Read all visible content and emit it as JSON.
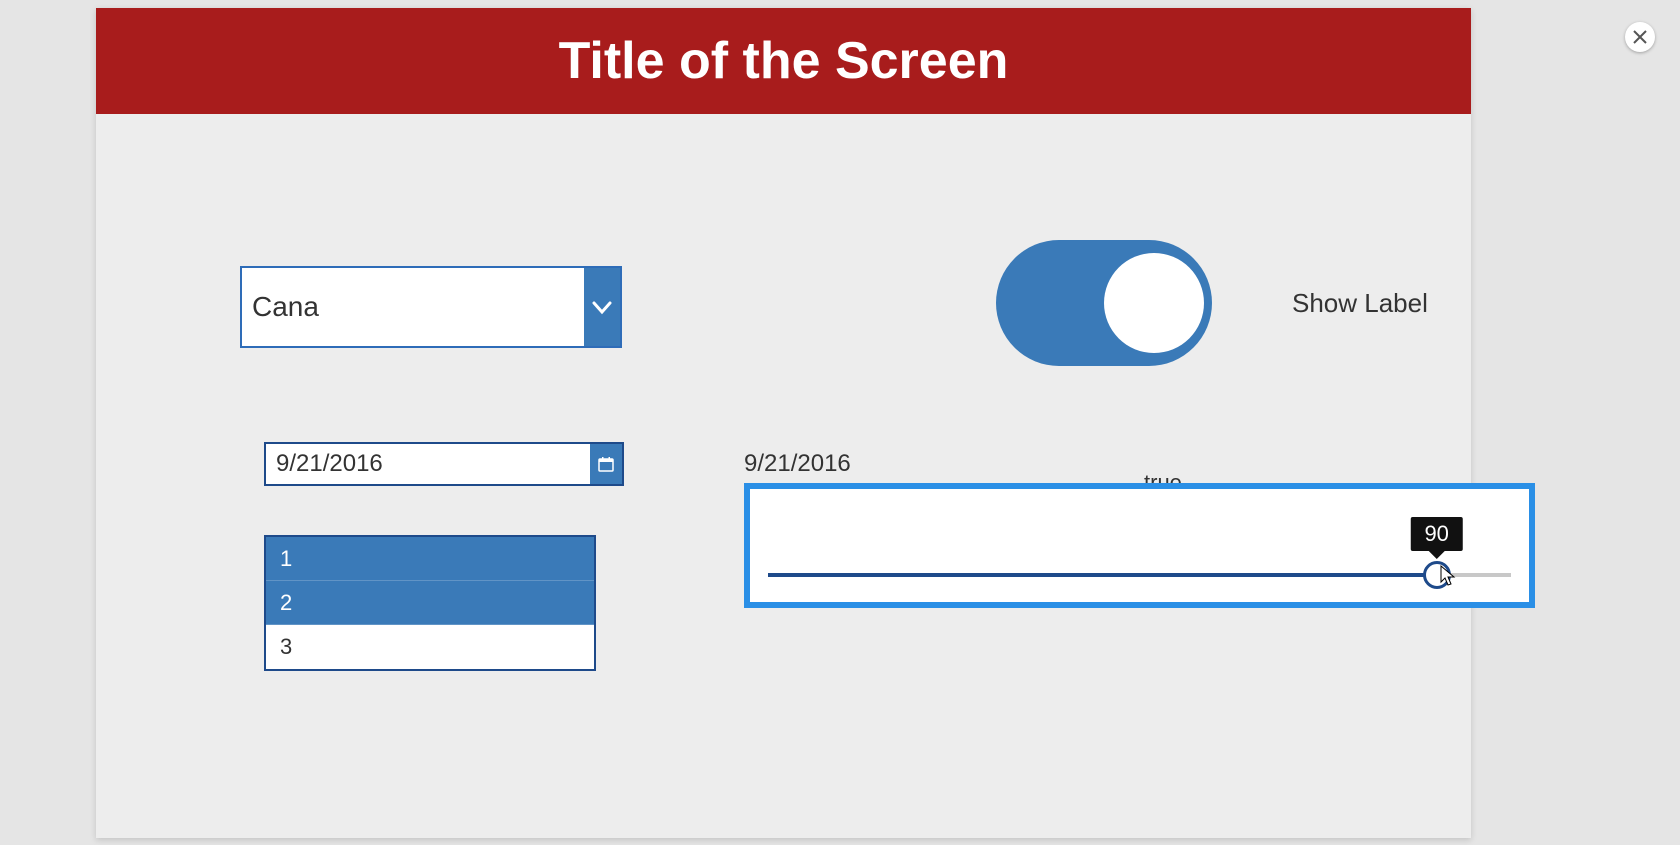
{
  "header": {
    "title": "Title of the Screen"
  },
  "dropdown": {
    "value": "Cana"
  },
  "toggle": {
    "label": "Show Label",
    "value_display": "true"
  },
  "date": {
    "value": "9/21/2016",
    "echo": "9/21/2016"
  },
  "listbox": {
    "items": [
      "1",
      "2",
      "3"
    ],
    "selected": [
      0,
      1
    ]
  },
  "slider": {
    "value": 90,
    "min": 0,
    "max": 100,
    "tooltip": "90"
  }
}
